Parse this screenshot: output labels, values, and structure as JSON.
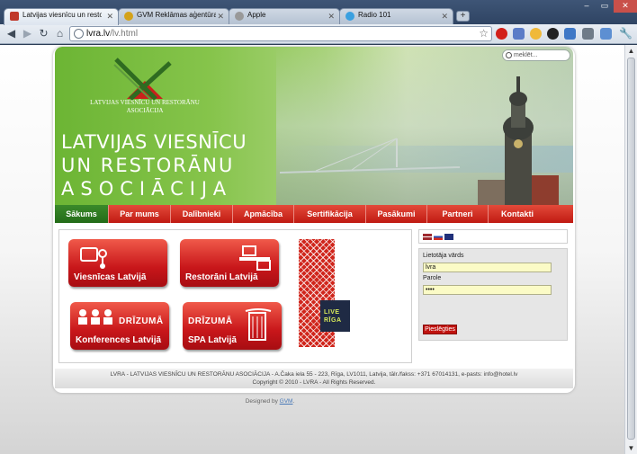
{
  "browser": {
    "tabs": [
      {
        "title": "Latvijas viesnīcu un restorānu",
        "active": true
      },
      {
        "title": "GVM Reklāmas aģentūra GVM",
        "active": false
      },
      {
        "title": "Apple",
        "active": false
      },
      {
        "title": "Radio 101",
        "active": false
      }
    ],
    "new_tab_label": "+",
    "url_host": "lvra.lv",
    "url_path": "/lv.html"
  },
  "site": {
    "search_placeholder": "meklēt...",
    "logo_text": "LATVIJAS VIESNĪCU UN RESTORĀNU ASOCIĀCIJA",
    "title_lines": [
      "LATVIJAS VIESNĪCU",
      "UN RESTORĀNU",
      "ASOCIĀCIJA"
    ],
    "nav": [
      "Sākums",
      "Par mums",
      "Dalībnieki",
      "Apmācība",
      "Sertifikācija",
      "Pasākumi",
      "Partneri",
      "Kontakti"
    ],
    "tiles": {
      "hotels": "Viesnīcas Latvijā",
      "restaurants": "Restorāni Latvijā",
      "conferences": "Konferences Latvijā",
      "spa": "SPA Latvijā",
      "soon": "DRĪZUMĀ"
    },
    "liveriga": {
      "line1": "LIVE",
      "line2": "RĪGA"
    },
    "login": {
      "username_label": "Lietotāja vārds",
      "username_value": "lvra",
      "password_label": "Parole",
      "password_value": "••••",
      "submit_label": "Pieslēgties"
    },
    "footer": {
      "line1": "LVRA - LATVIJAS VIESNĪCU UN RESTORĀNU ASOCIĀCIJA - A.Čaka iela 55 - 223, Rīga, LV1011, Latvija, tālr./fakss: +371 67014131, e-pasts: info@hotel.lv",
      "line2": "Copyright © 2010 - LVRA - All Rights Reserved."
    },
    "designed_by_prefix": "Designed by",
    "designed_by_link": "GVM"
  },
  "colors": {
    "nav_red": "#c01a12",
    "nav_active_green": "#236b18",
    "header_green": "#6cb534"
  }
}
